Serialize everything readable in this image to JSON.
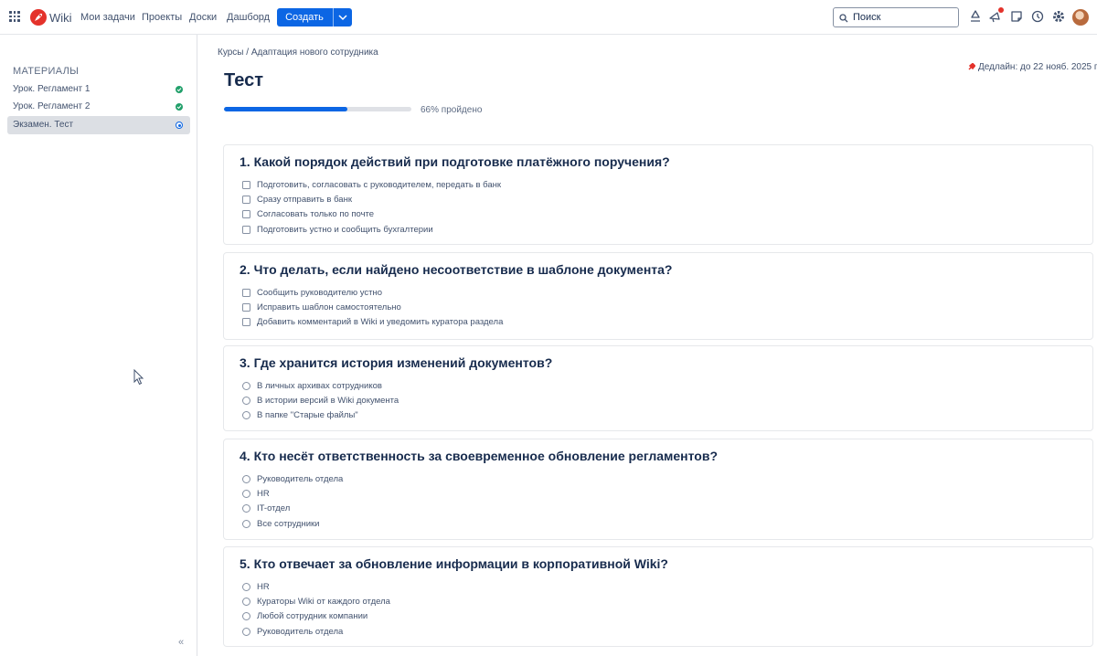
{
  "topbar": {
    "brand": "Wiki",
    "nav": [
      "Мои задачи",
      "Проекты",
      "Доски",
      "Дашборд"
    ],
    "create_label": "Создать",
    "search_label": "Поиск",
    "icons": [
      "app-grid-icon",
      "wiki-logo-icon",
      "search-icon",
      "recycle-icon",
      "megaphone-icon",
      "notes-icon",
      "history-icon",
      "settings-icon",
      "avatar"
    ],
    "accent_color": "#0c66e4",
    "notification_color": "#e4322b"
  },
  "sidebar": {
    "title": "МАТЕРИАЛЫ",
    "items": [
      {
        "label": "Урок. Регламент 1",
        "status": "done"
      },
      {
        "label": "Урок. Регламент 2",
        "status": "done"
      },
      {
        "label": "Экзамен. Тест",
        "status": "in-progress"
      }
    ],
    "collapse_label": "«"
  },
  "main": {
    "breadcrumb": [
      "Курсы",
      "Адаптация нового сотрудника"
    ],
    "breadcrumb_sep": "/",
    "deadline": "Дедлайн: до 22 нояб. 2025 г.",
    "title": "Тест",
    "progress_fraction": 0.66,
    "progress_text": "66% пройдено",
    "questions": [
      {
        "title": "1. Какой порядок действий при подготовке платёжного поручения?",
        "type": "checkbox",
        "options": [
          "Подготовить, согласовать с руководителем, передать в банк",
          "Сразу отправить в банк",
          "Согласовать только по почте",
          "Подготовить устно и сообщить бухгалтерии"
        ]
      },
      {
        "title": "2. Что делать, если найдено несоответствие в шаблоне документа?",
        "type": "checkbox",
        "options": [
          "Сообщить руководителю устно",
          "Исправить шаблон самостоятельно",
          "Добавить комментарий в Wiki и уведомить куратора раздела"
        ]
      },
      {
        "title": "3. Где хранится история изменений документов?",
        "type": "radio",
        "options": [
          "В личных архивах сотрудников",
          "В истории версий в Wiki документа",
          "В папке \"Старые файлы\""
        ]
      },
      {
        "title": "4. Кто несёт ответственность за своевременное обновление регламентов?",
        "type": "radio",
        "options": [
          "Руководитель отдела",
          "HR",
          "IT-отдел",
          "Все сотрудники"
        ]
      },
      {
        "title": "5. Кто отвечает за обновление информации в корпоративной Wiki?",
        "type": "radio",
        "options": [
          "HR",
          "Кураторы Wiki от каждого отдела",
          "Любой сотрудник компании",
          "Руководитель отдела"
        ]
      }
    ]
  }
}
